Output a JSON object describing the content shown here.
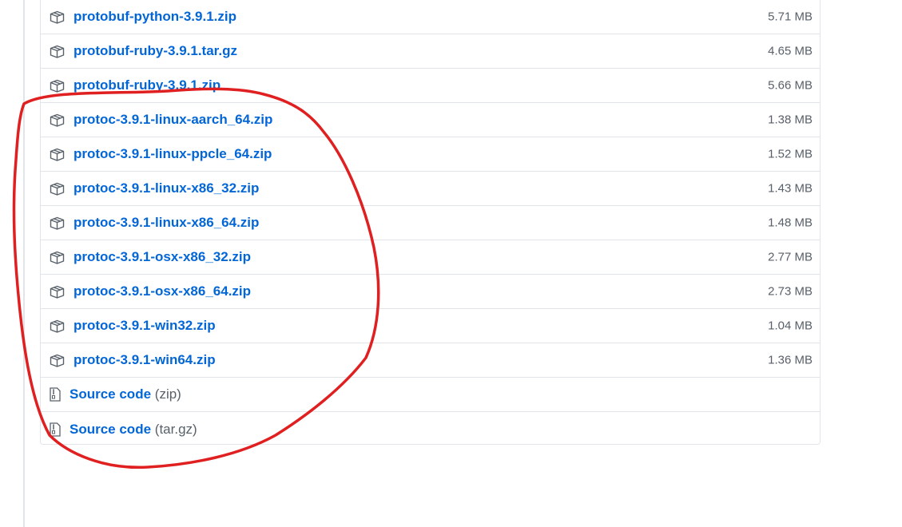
{
  "assets": [
    {
      "name": "protobuf-python-3.9.1.zip",
      "size": "5.71 MB"
    },
    {
      "name": "protobuf-ruby-3.9.1.tar.gz",
      "size": "4.65 MB"
    },
    {
      "name": "protobuf-ruby-3.9.1.zip",
      "size": "5.66 MB"
    },
    {
      "name": "protoc-3.9.1-linux-aarch_64.zip",
      "size": "1.38 MB"
    },
    {
      "name": "protoc-3.9.1-linux-ppcle_64.zip",
      "size": "1.52 MB"
    },
    {
      "name": "protoc-3.9.1-linux-x86_32.zip",
      "size": "1.43 MB"
    },
    {
      "name": "protoc-3.9.1-linux-x86_64.zip",
      "size": "1.48 MB"
    },
    {
      "name": "protoc-3.9.1-osx-x86_32.zip",
      "size": "2.77 MB"
    },
    {
      "name": "protoc-3.9.1-osx-x86_64.zip",
      "size": "2.73 MB"
    },
    {
      "name": "protoc-3.9.1-win32.zip",
      "size": "1.04 MB"
    },
    {
      "name": "protoc-3.9.1-win64.zip",
      "size": "1.36 MB"
    }
  ],
  "source_code": [
    {
      "label": "Source code",
      "ext": "(zip)"
    },
    {
      "label": "Source code",
      "ext": "(tar.gz)"
    }
  ],
  "icons": {
    "asset": "package-icon",
    "source": "file-zip-icon"
  },
  "colors": {
    "link": "#0366d6",
    "muted": "#586069",
    "border": "#e1e4e8",
    "annotation": "#e02020"
  }
}
